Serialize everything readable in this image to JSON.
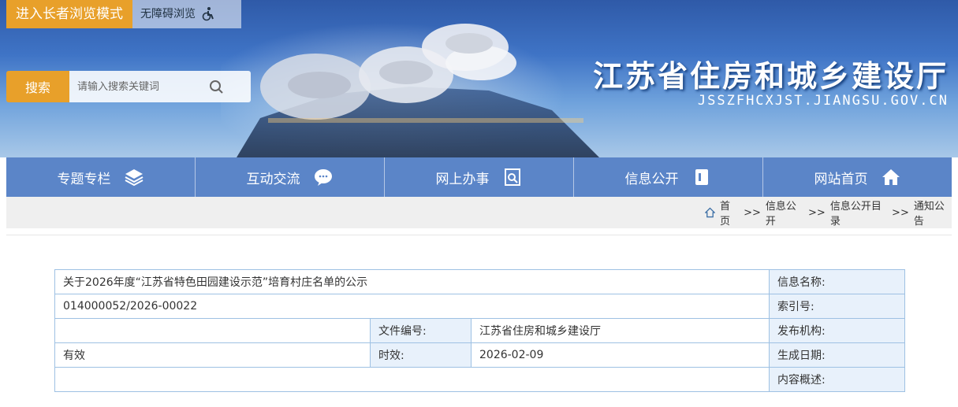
{
  "header": {
    "elder_mode_label": "进入长者浏览模式",
    "accessible_label": "无障碍浏览",
    "search_button": "搜索",
    "search_placeholder": "请输入搜索关键词",
    "site_title": "江苏省住房和城乡建设厅",
    "site_url": "JSSZFHCXJST.JIANGSU.GOV.CN"
  },
  "nav": {
    "items": [
      {
        "label": "专题专栏",
        "icon": "layers-icon"
      },
      {
        "label": "互动交流",
        "icon": "chat-icon"
      },
      {
        "label": "网上办事",
        "icon": "document-search-icon"
      },
      {
        "label": "信息公开",
        "icon": "info-doc-icon"
      },
      {
        "label": "网站首页",
        "icon": "home-icon"
      }
    ]
  },
  "breadcrumb": {
    "home": "首页",
    "level1": "信息公开",
    "level2": "信息公开目录",
    "level3": "通知公告",
    "separator": ">>"
  },
  "info_table": {
    "title_label": "信息名称:",
    "title_value": "关于2026年度“江苏省特色田园建设示范”培育村庄名单的公示",
    "index_label": "索引号:",
    "index_value": "014000052/2026-00022",
    "publisher_label": "发布机构:",
    "publisher_value": "江苏省住房和城乡建设厅",
    "doc_no_label": "文件编号:",
    "doc_no_value": "",
    "date_label": "生成日期:",
    "date_value": "2026-02-09",
    "validity_label": "时效:",
    "validity_value": "有效",
    "summary_label": "内容概述:",
    "summary_value": ""
  },
  "colors": {
    "accent_orange": "#e8a02a",
    "nav_blue": "#5b85c8",
    "table_border": "#9ec1e3",
    "label_bg": "#e8f1fb"
  }
}
